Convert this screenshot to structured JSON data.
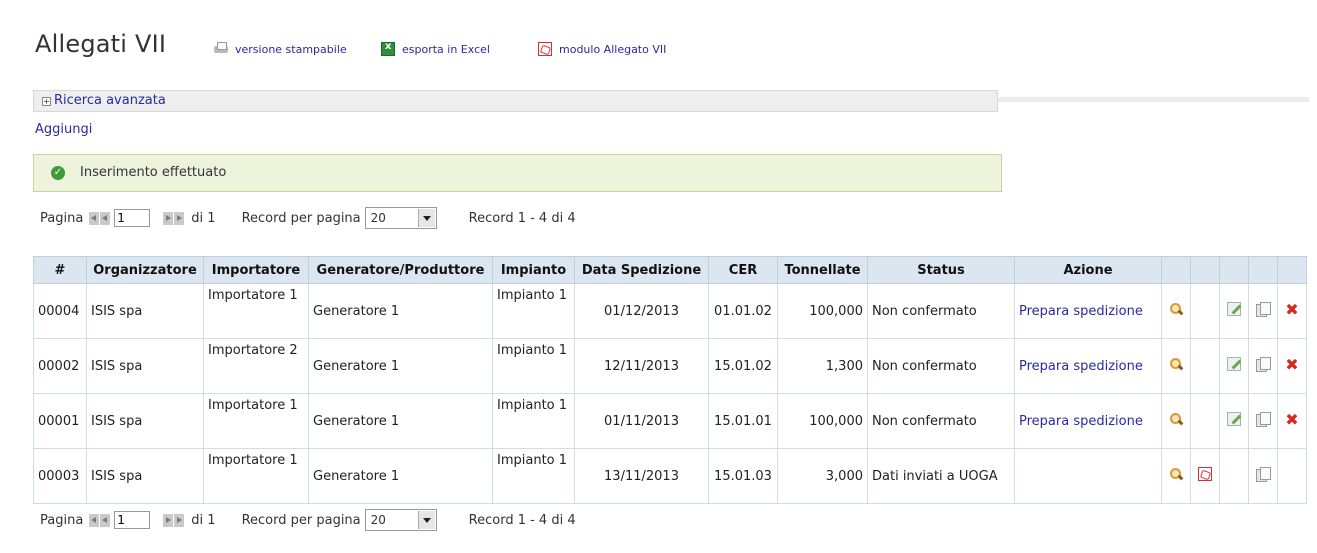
{
  "header": {
    "title": "Allegati VII",
    "links": [
      {
        "label": "versione stampabile",
        "icon": "printer-icon"
      },
      {
        "label": "esporta in Excel",
        "icon": "excel-icon"
      },
      {
        "label": "modulo Allegato VII",
        "icon": "pdf-icon"
      }
    ]
  },
  "search": {
    "label": "Ricerca avanzata"
  },
  "add": {
    "label": "Aggiungi"
  },
  "success": {
    "message": "Inserimento effettuato",
    "color": "#eef3dc"
  },
  "pager": {
    "page_label": "Pagina",
    "page_value": "1",
    "of_label": "di 1",
    "per_page_label": "Record per pagina",
    "per_page_value": "20",
    "records_label": "Record 1 - 4 di 4"
  },
  "table": {
    "columns": [
      "#",
      "Organizzatore",
      "Importatore",
      "Generatore/Produttore",
      "Impianto",
      "Data Spedizione",
      "CER",
      "Tonnellate",
      "Status",
      "Azione"
    ],
    "rows": [
      {
        "id": "00004",
        "org": "ISIS spa",
        "imp": "Importatore 1",
        "gen": "Generatore 1",
        "impianto": "Impianto 1",
        "data": "01/12/2013",
        "cer": "01.01.02",
        "ton": "100,000",
        "status": "Non confermato",
        "azione": "Prepara spedizione"
      },
      {
        "id": "00002",
        "org": "ISIS spa",
        "imp": "Importatore 2",
        "gen": "Generatore 1",
        "impianto": "Impianto 1",
        "data": "12/11/2013",
        "cer": "15.01.02",
        "ton": "1,300",
        "status": "Non confermato",
        "azione": "Prepara spedizione"
      },
      {
        "id": "00001",
        "org": "ISIS spa",
        "imp": "Importatore 1",
        "gen": "Generatore 1",
        "impianto": "Impianto 1",
        "data": "01/11/2013",
        "cer": "15.01.01",
        "ton": "100,000",
        "status": "Non confermato",
        "azione": "Prepara spedizione"
      },
      {
        "id": "00003",
        "org": "ISIS spa",
        "imp": "Importatore 1",
        "gen": "Generatore 1",
        "impianto": "Impianto 1",
        "data": "13/11/2013",
        "cer": "15.01.03",
        "ton": "3,000",
        "status": "Dati inviati a UOGA",
        "azione": ""
      }
    ]
  },
  "colors": {
    "link": "#2a2aa0",
    "header_bg": "#dbe6f0",
    "delete": "#d52a1e"
  }
}
